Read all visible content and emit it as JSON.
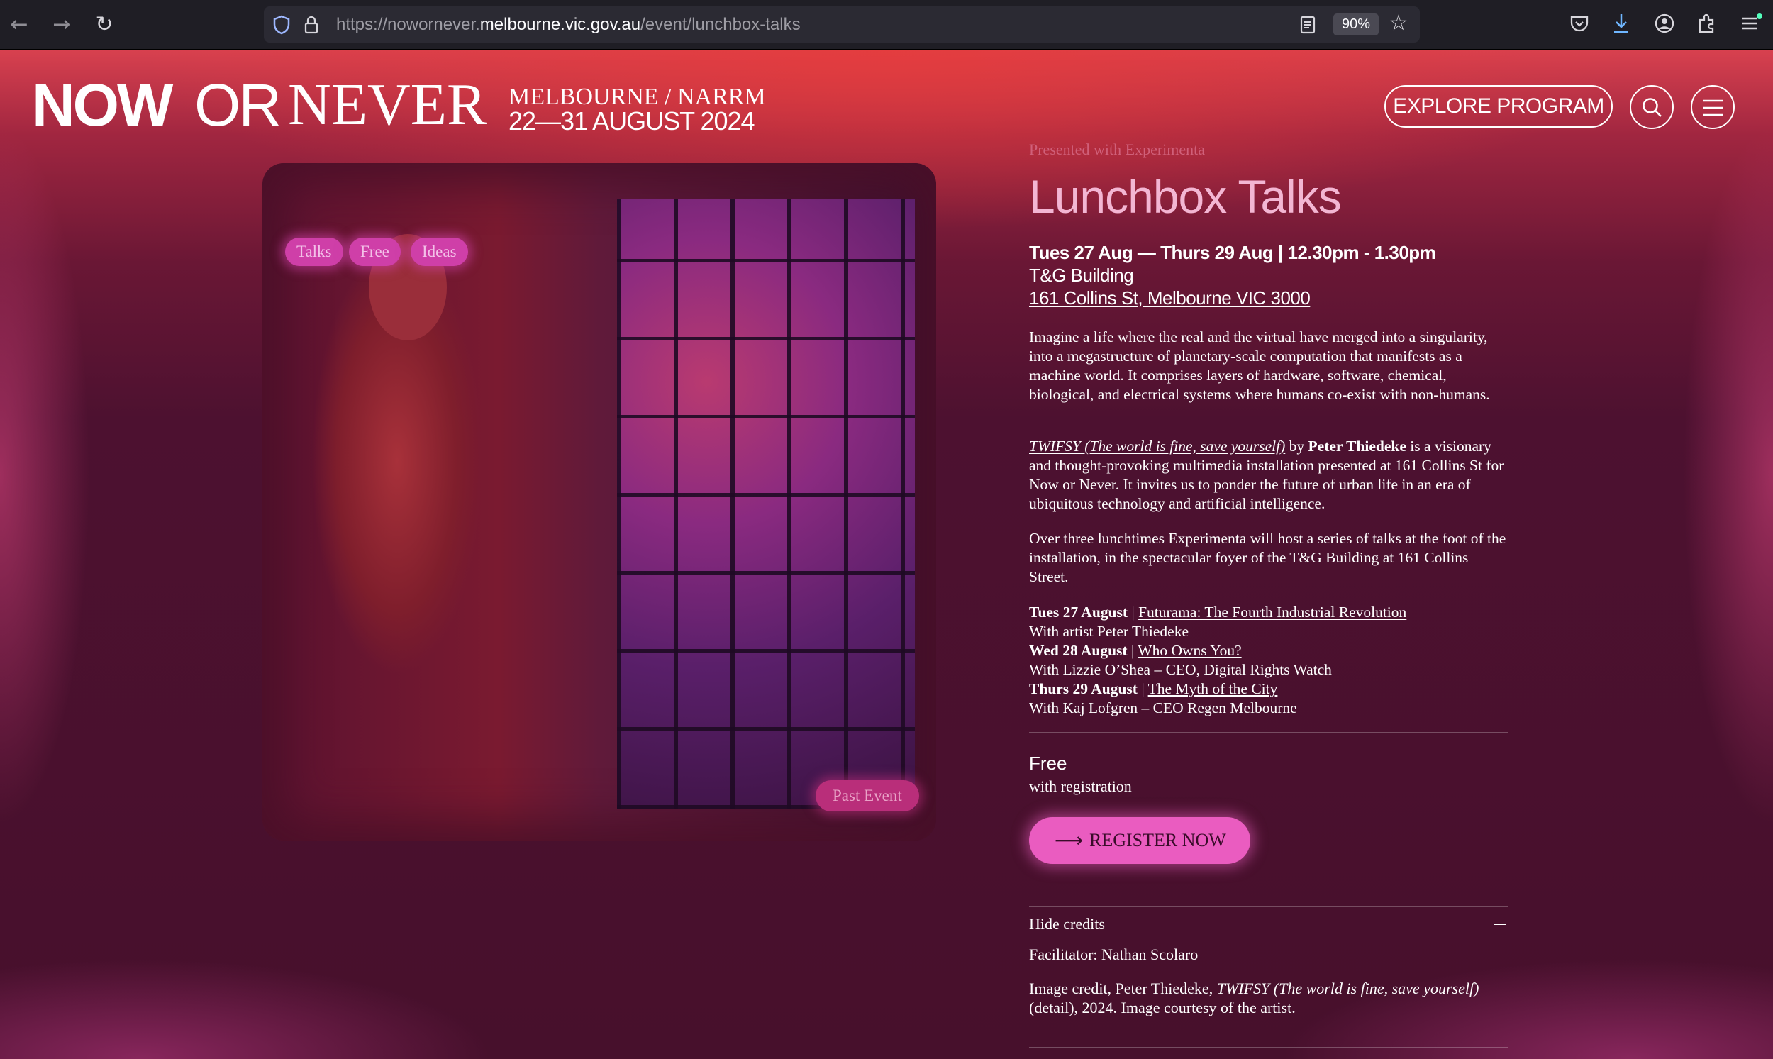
{
  "browser": {
    "url_prefix": "https://nowornever.",
    "url_domain": "melbourne.vic.gov.au",
    "url_path": "/event/lunchbox-talks",
    "zoom": "90%"
  },
  "header": {
    "logo_now": "NOW",
    "logo_or": "OR",
    "logo_never": "NEVER",
    "city": "MELBOURNE / NARRM",
    "dates": "22—31 AUGUST 2024",
    "explore_label": "EXPLORE PROGRAM"
  },
  "hero": {
    "tags": [
      "Talks",
      "Free",
      "Ideas"
    ],
    "status": "Past Event"
  },
  "event": {
    "presented": "Presented with Experimenta",
    "title": "Lunchbox Talks",
    "when": "Tues 27 Aug — Thurs 29 Aug | 12.30pm - 1.30pm",
    "venue": "T&G Building",
    "address": "161 Collins St, Melbourne VIC 3000",
    "intro": "Imagine a life where the real and the virtual have merged into a singularity, into a megastructure of planetary-scale computation that manifests as a machine world. It comprises layers of hardware, software, chemical, biological, and electrical systems where humans co-exist with non-humans.",
    "p2_link": "TWIFSY (The world is fine, save yourself)",
    "p2_by": " by ",
    "p2_artist": "Peter Thiedeke",
    "p2_rest": " is a visionary and thought-provoking multimedia installation presented at 161 Collins St for Now or Never. It invites us to ponder the future of urban life in an era of ubiquitous technology and artificial intelligence.",
    "p3": "Over three lunchtimes Experimenta will host a series of talks at the foot of the installation, in the spectacular foyer of the T&G Building at 161 Collins Street.",
    "schedule": [
      {
        "day": "Tues 27 August",
        "sep": " | ",
        "talk": "Futurama: The Fourth Industrial Revolution",
        "with": "With artist Peter Thiedeke"
      },
      {
        "day": "Wed 28 August",
        "sep": " | ",
        "talk": "Who Owns You?",
        "with": "With Lizzie O’Shea – CEO, Digital Rights Watch"
      },
      {
        "day": "Thurs 29 August",
        "sep": " | ",
        "talk": "The Myth of the City",
        "with": "With Kaj Lofgren – CEO Regen Melbourne"
      }
    ],
    "price": "Free",
    "price_note": "with registration",
    "register_label": "REGISTER NOW",
    "credits_toggle": "Hide credits",
    "facilitator": "Facilitator: Nathan Scolaro",
    "credit_a": "Image credit, Peter Thiedeke, ",
    "credit_italic": "TWIFSY (The world is fine, save yourself)",
    "credit_b": " (detail), 2024. Image courtesy of the artist."
  },
  "colors": {
    "page_bg": "#4a1028",
    "title_pink": "#f3b6d3",
    "tag_pink": "#cf3fa8",
    "register_pink": "#ea5cc0"
  },
  "icons": [
    "back-icon",
    "forward-icon",
    "reload-icon",
    "shield-icon",
    "lock-icon",
    "reader-icon",
    "star-icon",
    "pocket-icon",
    "download-icon",
    "account-icon",
    "extensions-icon",
    "menu-icon",
    "search-icon",
    "hamburger-icon",
    "arrow-right-icon",
    "minus-icon"
  ]
}
